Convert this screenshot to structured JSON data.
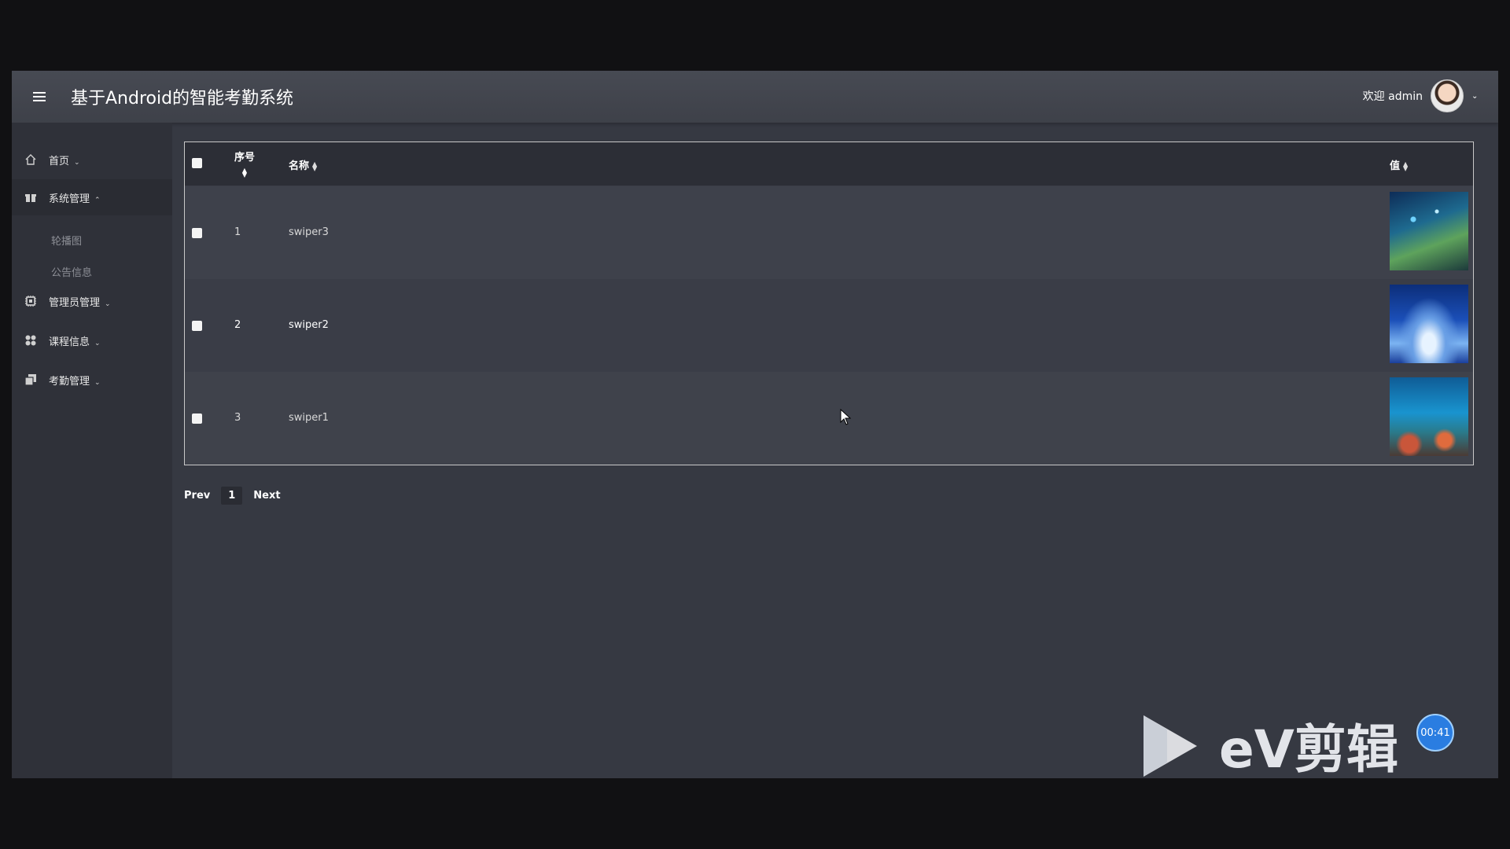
{
  "header": {
    "title": "基于Android的智能考勤系统",
    "welcome": "欢迎 admin"
  },
  "sidebar": {
    "items": [
      {
        "label": "首页",
        "icon": "home-icon",
        "expanded": false
      },
      {
        "label": "系统管理",
        "icon": "gift-icon",
        "expanded": true,
        "children": [
          "轮播图",
          "公告信息"
        ]
      },
      {
        "label": "管理员管理",
        "icon": "chip-icon",
        "expanded": false
      },
      {
        "label": "课程信息",
        "icon": "apps-icon",
        "expanded": false
      },
      {
        "label": "考勤管理",
        "icon": "copy-icon",
        "expanded": false
      }
    ]
  },
  "table": {
    "columns": [
      "序号",
      "名称",
      "值"
    ],
    "rows": [
      {
        "index": "1",
        "name": "swiper3",
        "image": "coral-reef-image"
      },
      {
        "index": "2",
        "name": "swiper2",
        "image": "ocean-wave-image"
      },
      {
        "index": "3",
        "name": "swiper1",
        "image": "reef-fish-image"
      }
    ]
  },
  "pagination": {
    "prev": "Prev",
    "current": "1",
    "next": "Next"
  },
  "overlay": {
    "timer": "00:41",
    "watermark": "eV剪辑"
  },
  "colors": {
    "background": "#363942",
    "sidebar": "#2f3139",
    "topbar": "#474a53",
    "timer": "#2a7de1"
  }
}
